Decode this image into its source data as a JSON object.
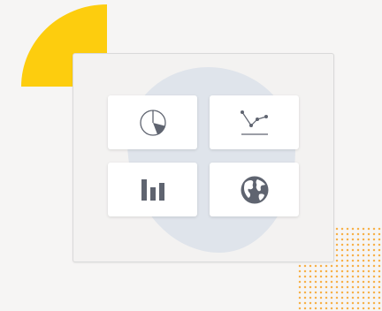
{
  "tiles": [
    {
      "icon": "pie-chart-icon"
    },
    {
      "icon": "line-chart-icon"
    },
    {
      "icon": "bar-chart-icon"
    },
    {
      "icon": "globe-icon"
    }
  ],
  "colors": {
    "background": "#f6f5f4",
    "accent_yellow": "#fdcd0e",
    "dot_orange": "#f7b14a",
    "blob": "#dfe4eb",
    "icon": "#5f6470",
    "card": "#f3f2f1"
  }
}
